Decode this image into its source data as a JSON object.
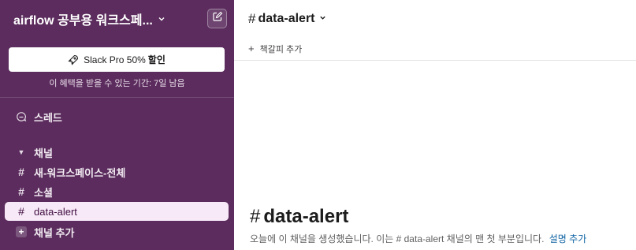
{
  "workspace": {
    "name": "airflow 공부용 워크스페...",
    "promo_label": "Slack Pro 50%",
    "promo_strong": "할인",
    "promo_sub": "이 혜택을 받을 수 있는 기간: 7일 남음"
  },
  "sidebar": {
    "threads_label": "스레드",
    "channels_section": "채널",
    "channels": [
      {
        "label": "새-워크스페이스-전체",
        "active": false
      },
      {
        "label": "소셜",
        "active": false
      },
      {
        "label": "data-alert",
        "active": true
      }
    ],
    "add_channel": "채널 추가"
  },
  "channel": {
    "name": "data-alert",
    "bookmark_add": "책갈피 추가",
    "intro_title": "data-alert",
    "intro_desc_prefix": "오늘에 이 채널을 생성했습니다. 이는",
    "intro_channel": "# data-alert",
    "intro_desc_suffix": "채널의 맨 첫 부분입니다.",
    "intro_link": "설명 추가"
  },
  "colors": {
    "sidebar_bg": "#5b2c5d",
    "active_bg": "#f8e9f8",
    "link": "#1264a3"
  }
}
